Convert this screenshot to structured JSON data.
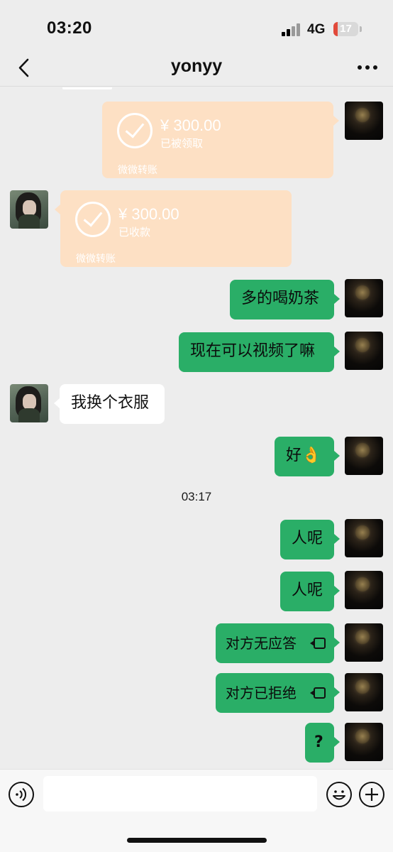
{
  "status": {
    "time": "03:20",
    "network": "4G",
    "battery": "17",
    "battery_level": 0.17
  },
  "nav": {
    "title": "yonyy",
    "back_icon": "chevron-left-icon",
    "more_icon": "more-dots-icon"
  },
  "transfers": [
    {
      "sender": "self",
      "amount": "¥ 300.00",
      "status": "已被领取",
      "label": "微微转账"
    },
    {
      "sender": "other",
      "amount": "¥ 300.00",
      "status": "已收款",
      "label": "微微转账"
    }
  ],
  "messages": [
    {
      "sender": "self",
      "text": "多的喝奶茶"
    },
    {
      "sender": "self",
      "text": "现在可以视频了嘛"
    },
    {
      "sender": "other",
      "text": "我换个衣服"
    },
    {
      "sender": "self",
      "text": "好👌"
    },
    {
      "sender": "self",
      "text": "人呢"
    },
    {
      "sender": "self",
      "text": "人呢"
    },
    {
      "sender": "self",
      "text": "对方无应答",
      "type": "video-call"
    },
    {
      "sender": "self",
      "text": "对方已拒绝",
      "type": "video-call"
    },
    {
      "sender": "self",
      "text": "?"
    }
  ],
  "time_separator": "03:17",
  "input": {
    "value": "",
    "voice_icon": "voice-icon",
    "emoji_icon": "emoji-icon",
    "add_icon": "plus-icon"
  },
  "colors": {
    "self_bubble": "#2aae67",
    "other_bubble": "#ffffff",
    "transfer": "#fde0c4",
    "background": "#ededed"
  }
}
